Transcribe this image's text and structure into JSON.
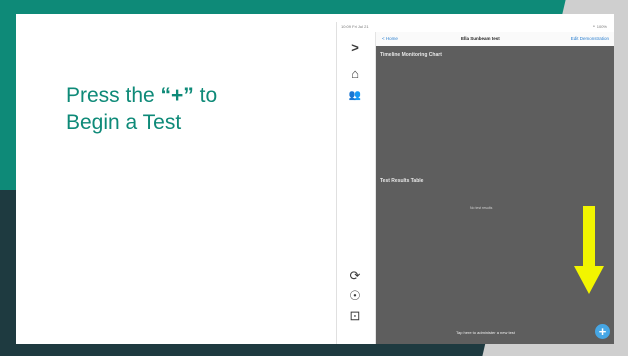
{
  "slide": {
    "instruction": {
      "before": "Press the ",
      "plus": "“+”",
      "after": " to",
      "line2": "Begin a Test"
    }
  },
  "ipad": {
    "status_time": "10:09 Fri Jul 21",
    "status_battery": "⚬ 100%",
    "nav_back": "< Home",
    "nav_title": "Ella Sunbeam test",
    "nav_right": "Edit Demonstration",
    "section_timeline": "Timeline Monitoring Chart",
    "section_results": "Test Results Table",
    "results_empty": "No test results",
    "fab_hint": "Tap here to administer a new test",
    "fab_symbol": "+"
  },
  "rail": {
    "expand": ">",
    "home": "⌂",
    "people": "👥",
    "sync": "⟳",
    "account": "☉",
    "settings": "⊡"
  },
  "colors": {
    "accent": "#0e8a78",
    "arrow": "#f2f500",
    "fab": "#46a6e4",
    "dark": "#1e3a40"
  }
}
